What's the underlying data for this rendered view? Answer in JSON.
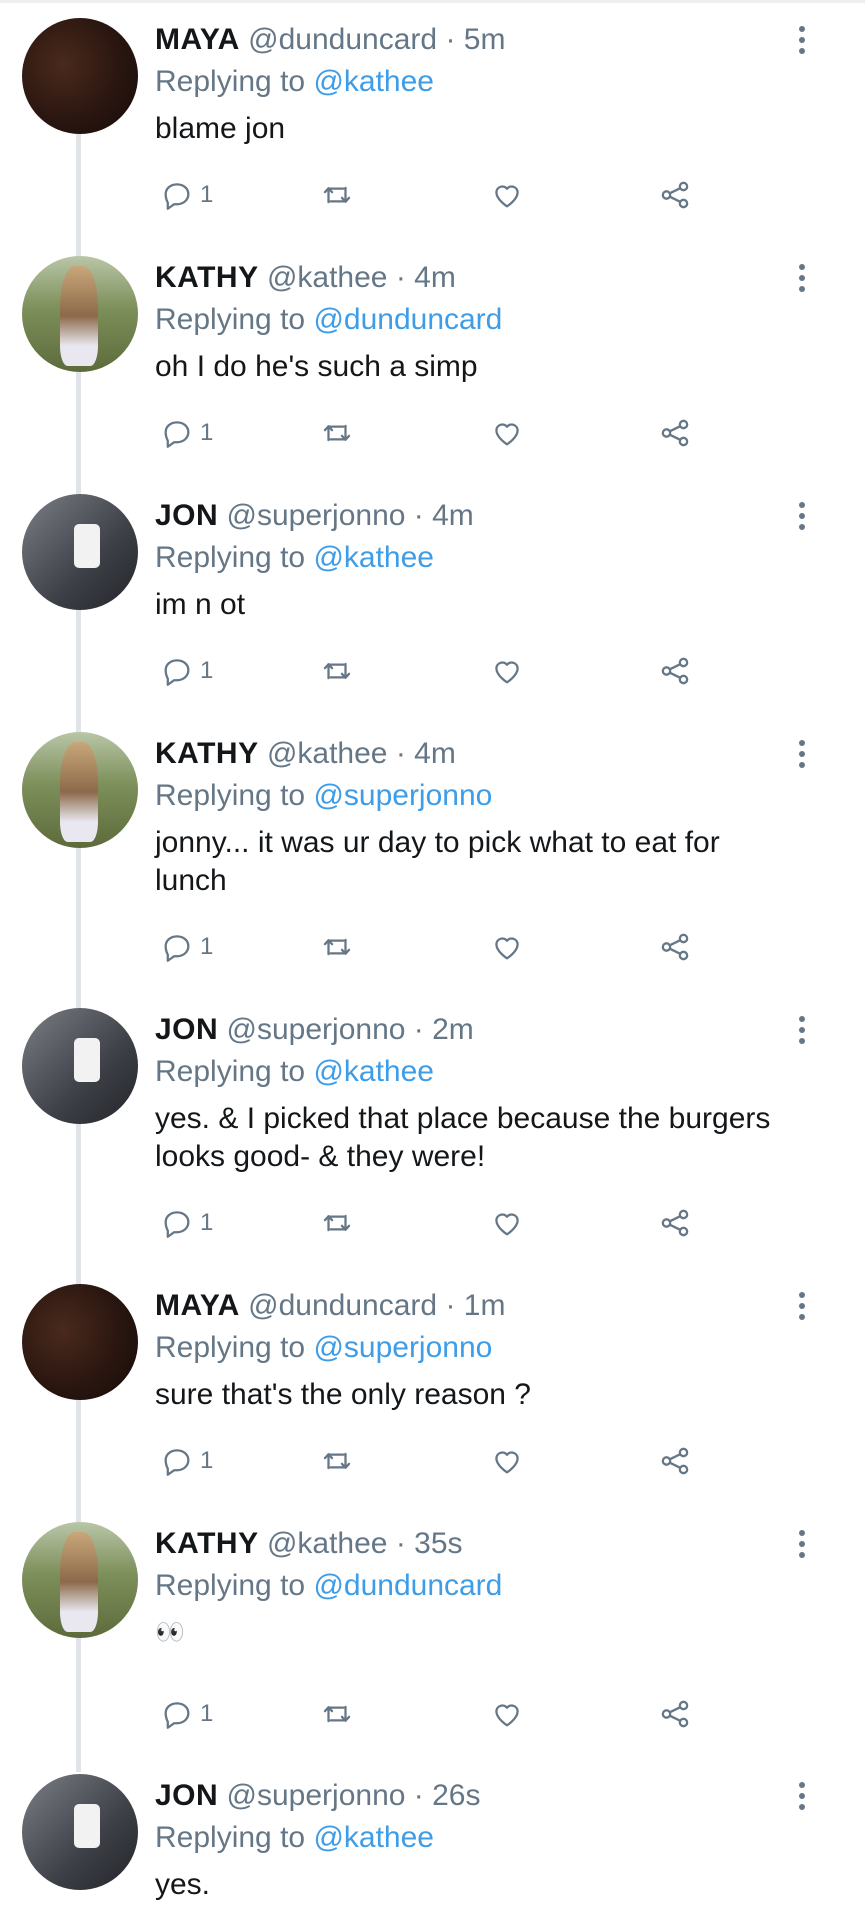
{
  "tweets": [
    {
      "name": "MAYA",
      "handle": "@dunduncard",
      "time": "· 5m",
      "reply_prefix": "Replying to",
      "reply_to": "@kathee",
      "text": "blame jon",
      "reply_count": "1",
      "avatar": "maya"
    },
    {
      "name": "KATHY",
      "handle": "@kathee",
      "time": "· 4m",
      "reply_prefix": "Replying to",
      "reply_to": "@dunduncard",
      "text": "oh I do he's such a simp",
      "reply_count": "1",
      "avatar": "kathy"
    },
    {
      "name": "JON",
      "handle": "@superjonno",
      "time": "· 4m",
      "reply_prefix": "Replying to",
      "reply_to": "@kathee",
      "text": "im n ot",
      "reply_count": "1",
      "avatar": "jon"
    },
    {
      "name": "KATHY",
      "handle": "@kathee",
      "time": "· 4m",
      "reply_prefix": "Replying to",
      "reply_to": "@superjonno",
      "text": "jonny... it was ur day to pick what to eat for lunch",
      "reply_count": "1",
      "avatar": "kathy"
    },
    {
      "name": "JON",
      "handle": "@superjonno",
      "time": "· 2m",
      "reply_prefix": "Replying to",
      "reply_to": "@kathee",
      "text": "yes. & I picked that place because the burgers looks good- & they were!",
      "reply_count": "1",
      "avatar": "jon"
    },
    {
      "name": "MAYA",
      "handle": "@dunduncard",
      "time": "· 1m",
      "reply_prefix": "Replying to",
      "reply_to": "@superjonno",
      "text": "sure that's the only reason ?",
      "reply_count": "1",
      "avatar": "maya"
    },
    {
      "name": "KATHY",
      "handle": "@kathee",
      "time": "· 35s",
      "reply_prefix": "Replying to",
      "reply_to": "@dunduncard",
      "text": "👀",
      "reply_count": "1",
      "avatar": "kathy"
    },
    {
      "name": "JON",
      "handle": "@superjonno",
      "time": "· 26s",
      "reply_prefix": "Replying to",
      "reply_to": "@kathee",
      "text": "yes.",
      "reply_count": "",
      "avatar": "jon"
    }
  ],
  "colors": {
    "link": "#3d9de8",
    "muted": "#657786",
    "text": "#14171a"
  },
  "icons": [
    "reply-icon",
    "retweet-icon",
    "like-icon",
    "share-icon",
    "more-icon"
  ]
}
